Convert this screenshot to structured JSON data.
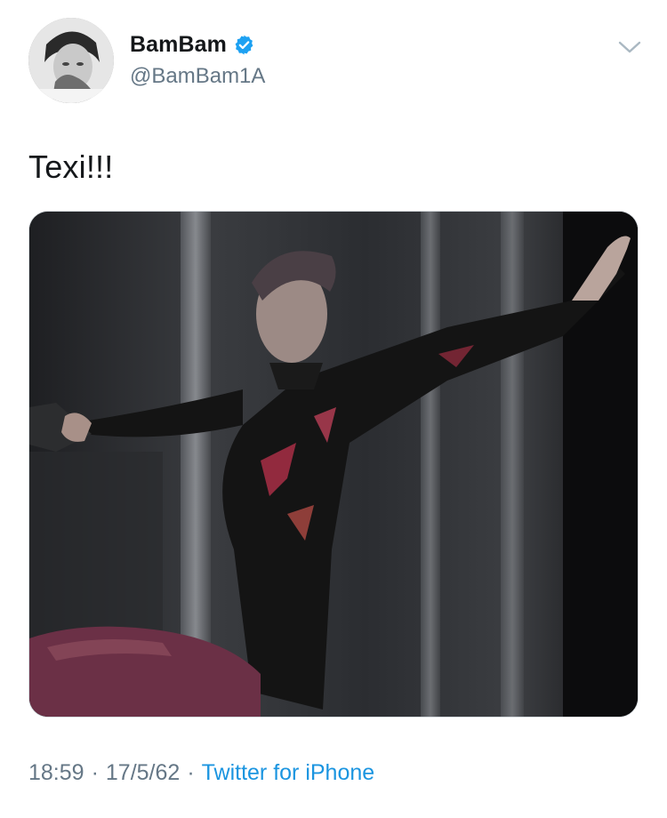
{
  "user": {
    "display_name": "BamBam",
    "handle": "@BamBam1A",
    "verified": true
  },
  "tweet": {
    "text": "Texi!!!",
    "time": "18:59",
    "date": "17/5/62",
    "source": "Twitter for iPhone",
    "separator": "·"
  },
  "icons": {
    "verified": "verified-badge-icon",
    "more": "chevron-down-icon"
  },
  "colors": {
    "name": "#14171a",
    "secondary": "#657786",
    "link": "#1b95e0",
    "verified": "#1da1f2"
  }
}
